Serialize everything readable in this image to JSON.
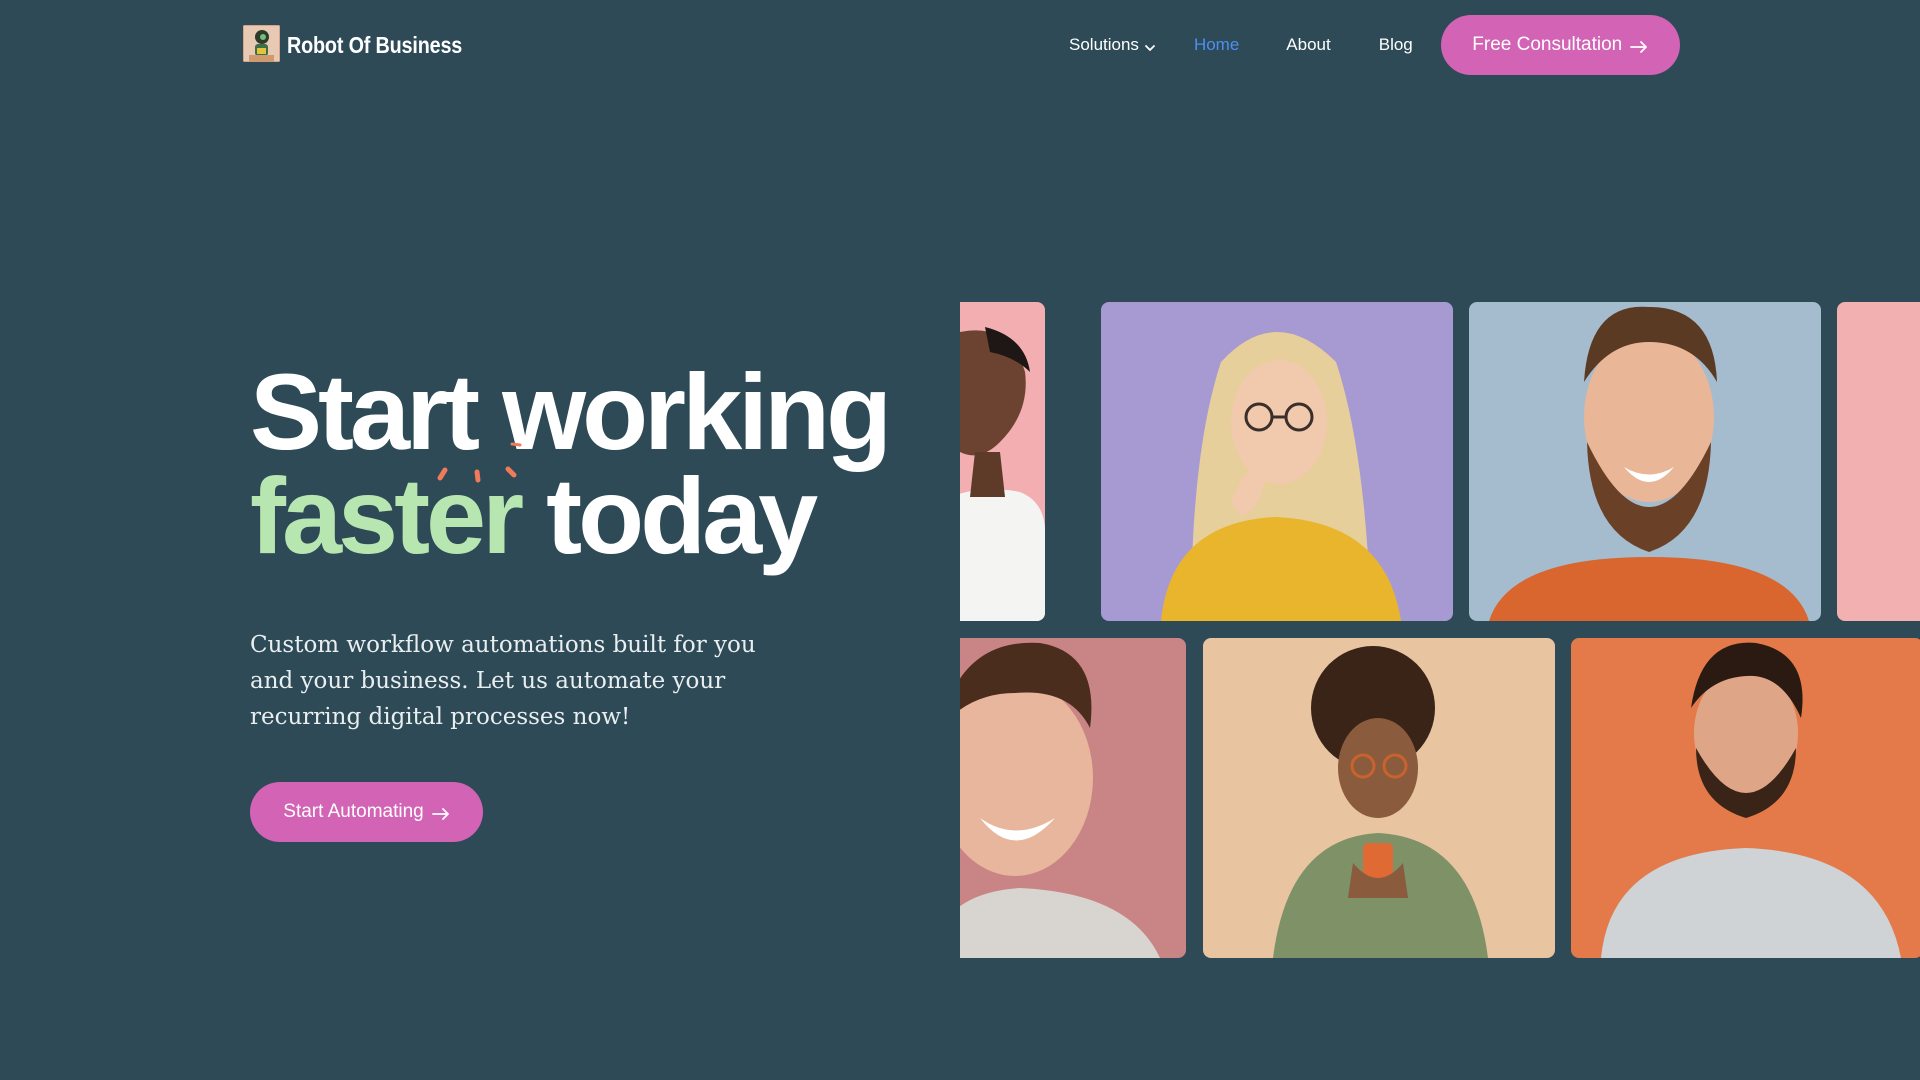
{
  "brand": {
    "name": "Robot Of Business"
  },
  "nav": {
    "solutions": "Solutions",
    "home": "Home",
    "about": "About",
    "blog": "Blog",
    "cta": "Free Consultation"
  },
  "hero": {
    "line1": "Start working",
    "accent": "faster",
    "line2_rest": "today",
    "subcopy": "Custom workflow automations built for you and your business. Let us automate your recurring digital processes now!",
    "cta": "Start Automating"
  },
  "colors": {
    "background": "#2d4a56",
    "accent_pink": "#d363b5",
    "accent_green": "#b8e6b1",
    "nav_active": "#4d8ff0",
    "spark": "#f07a5a"
  },
  "gallery": {
    "tiles": [
      {
        "icon": "portrait-man-looking-up-photo",
        "bg": "#f2aeb0"
      },
      {
        "icon": "portrait-woman-glasses-thinking-photo",
        "bg": "#a79ad3"
      },
      {
        "icon": "portrait-man-beard-smiling-photo",
        "bg": "#a4bccd"
      },
      {
        "icon": "portrait-partial-pink-photo",
        "bg": "#f3b0b1"
      },
      {
        "icon": "portrait-young-man-smiling-photo",
        "bg": "#c98486"
      },
      {
        "icon": "portrait-woman-curly-phone-photo",
        "bg": "#e8c4a0"
      },
      {
        "icon": "portrait-man-beard-orange-photo",
        "bg": "#e47a4a"
      }
    ]
  }
}
